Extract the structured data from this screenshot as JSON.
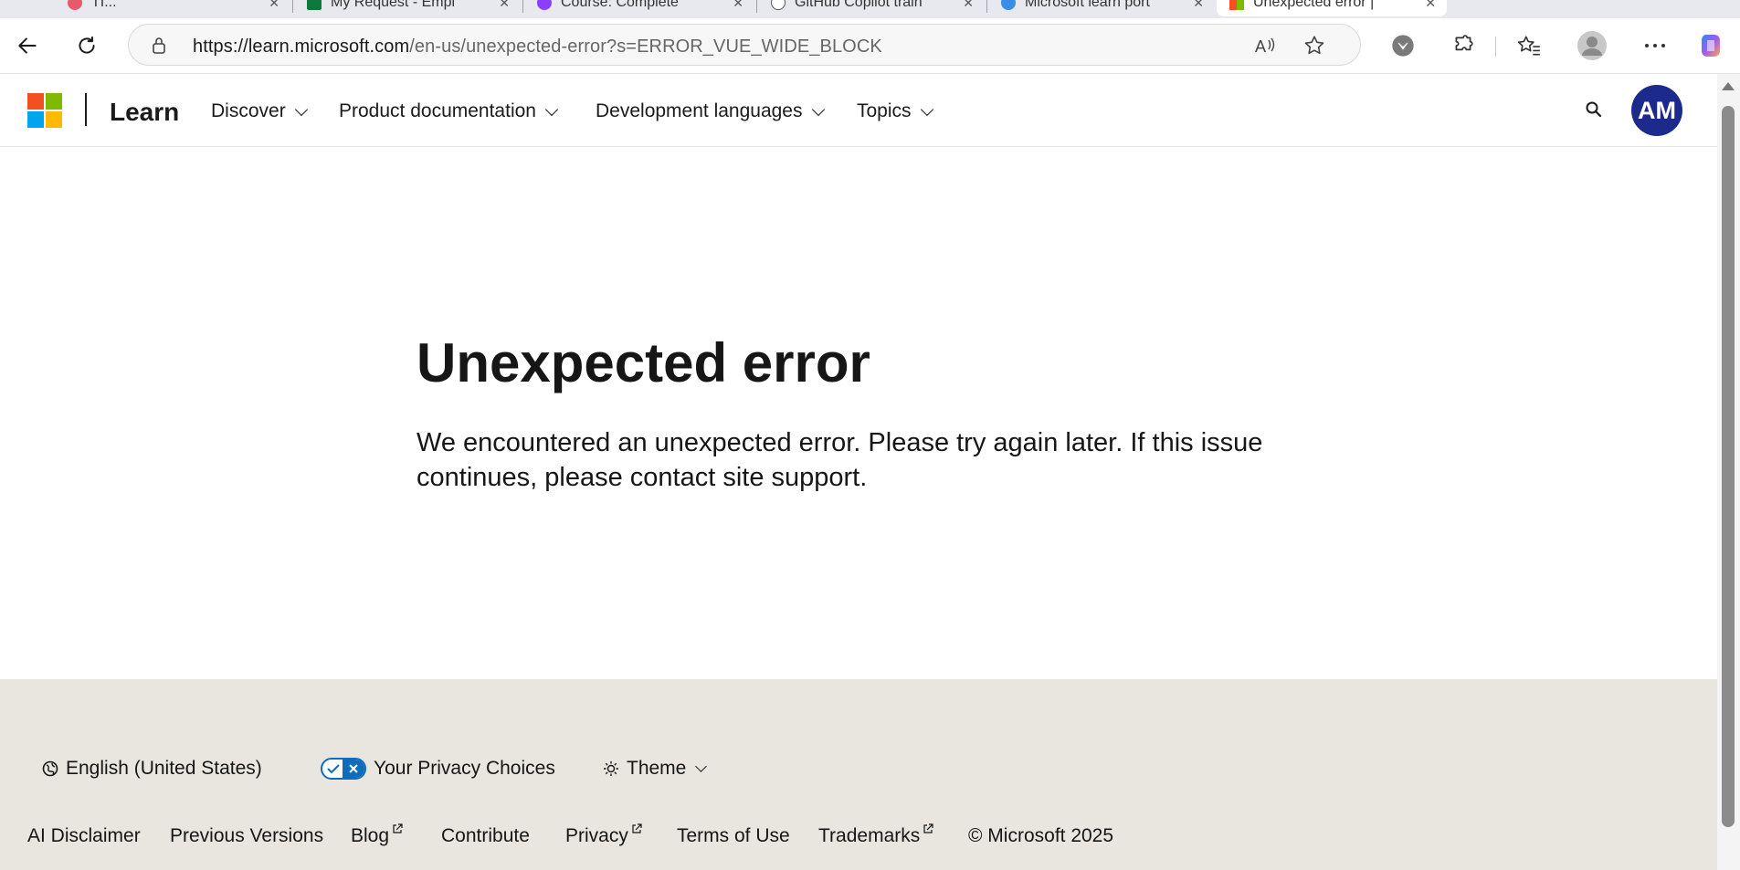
{
  "browser": {
    "tabs": [
      {
        "title": "TI..."
      },
      {
        "title": "My Request - Empl"
      },
      {
        "title": "Course: Complete"
      },
      {
        "title": "GitHub Copilot train"
      },
      {
        "title": "Microsoft learn port"
      },
      {
        "title": "Unexpected error |"
      }
    ],
    "tab_close": "✕",
    "url_host": "https://learn.microsoft.com",
    "url_path": "/en-us/unexpected-error?s=ERROR_VUE_WIDE_BLOCK"
  },
  "header": {
    "brand": "Learn",
    "nav": [
      {
        "label": "Discover"
      },
      {
        "label": "Product documentation"
      },
      {
        "label": "Development languages"
      },
      {
        "label": "Topics"
      }
    ],
    "avatar_initials": "AM"
  },
  "main": {
    "title": "Unexpected error",
    "message": "We encountered an unexpected error. Please try again later. If this issue continues, please contact site support."
  },
  "footer": {
    "language": "English (United States)",
    "privacy": "Your Privacy Choices",
    "theme": "Theme",
    "links": [
      {
        "label": "AI Disclaimer",
        "external": false
      },
      {
        "label": "Previous Versions",
        "external": false
      },
      {
        "label": "Blog",
        "external": true
      },
      {
        "label": "Contribute",
        "external": false
      },
      {
        "label": "Privacy",
        "external": true
      },
      {
        "label": "Terms of Use",
        "external": false
      },
      {
        "label": "Trademarks",
        "external": true
      }
    ],
    "copyright": "© Microsoft 2025"
  },
  "colors": {
    "avatar_bg": "#1b2a8c",
    "footer_bg": "#e8e6df",
    "privacy_toggle": "#0f6cbd",
    "ms_red": "#f25022",
    "ms_green": "#7fba00",
    "ms_blue": "#00a4ef",
    "ms_yellow": "#ffb900"
  },
  "icons": [
    "back-arrow-icon",
    "refresh-icon",
    "lock-icon",
    "read-aloud-icon",
    "favorite-star-icon",
    "shield-extension-icon",
    "extensions-puzzle-icon",
    "favorites-icon",
    "profile-icon",
    "more-icon",
    "copilot-icon",
    "search-icon",
    "globe-icon",
    "sun-icon",
    "external-link-icon"
  ]
}
